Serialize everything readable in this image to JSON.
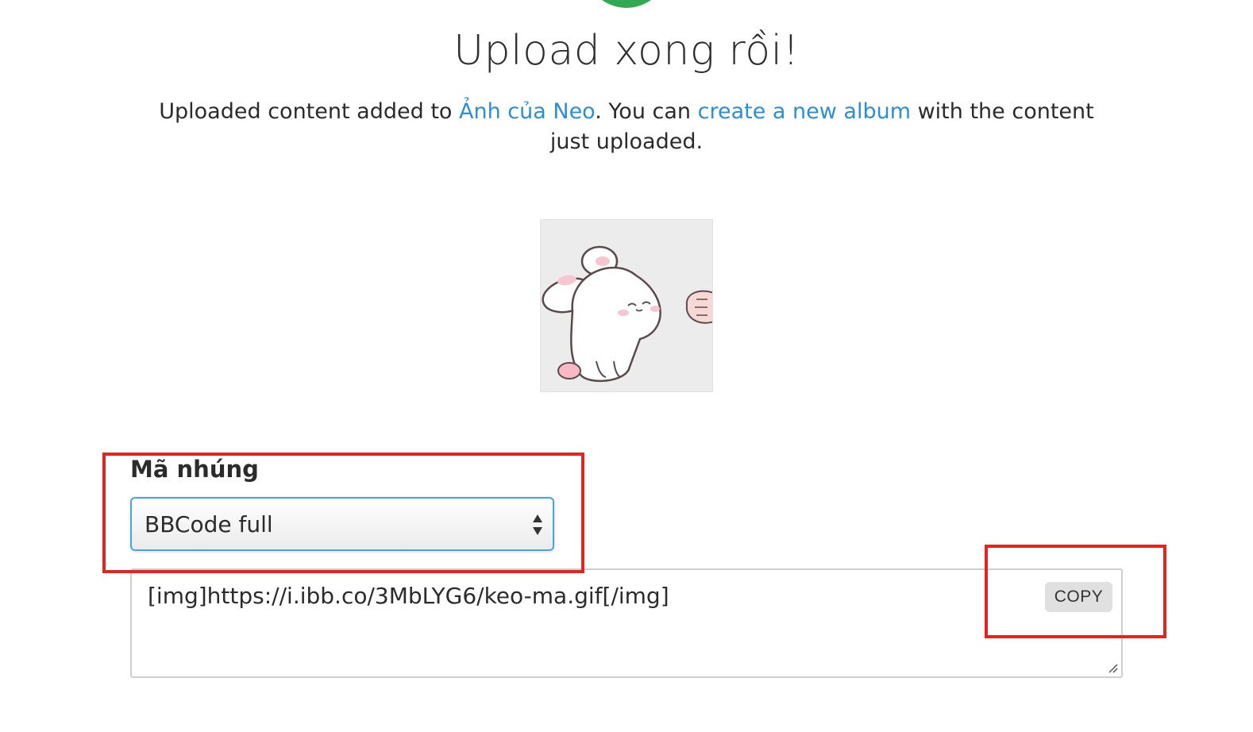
{
  "header": {
    "status_icon": "success-check-circle",
    "status_color": "#33a853",
    "title": "Upload xong rồi!"
  },
  "message": {
    "prefix": "Uploaded content added to ",
    "album_link": "Ảnh của Neo",
    "middle": ". You can ",
    "new_album_link": "create a new album",
    "suffix": " with the content just uploaded."
  },
  "thumbnail": {
    "alt": "keo-ma"
  },
  "embed": {
    "label": "Mã nhúng",
    "selected_option": "BBCode full",
    "code": "[img]https://i.ibb.co/3MbLYG6/keo-ma.gif[/img]",
    "copy_label": "COPY"
  },
  "colors": {
    "link": "#2a8fd6",
    "highlight": "#e5231f",
    "select_border": "#4aa6da"
  }
}
